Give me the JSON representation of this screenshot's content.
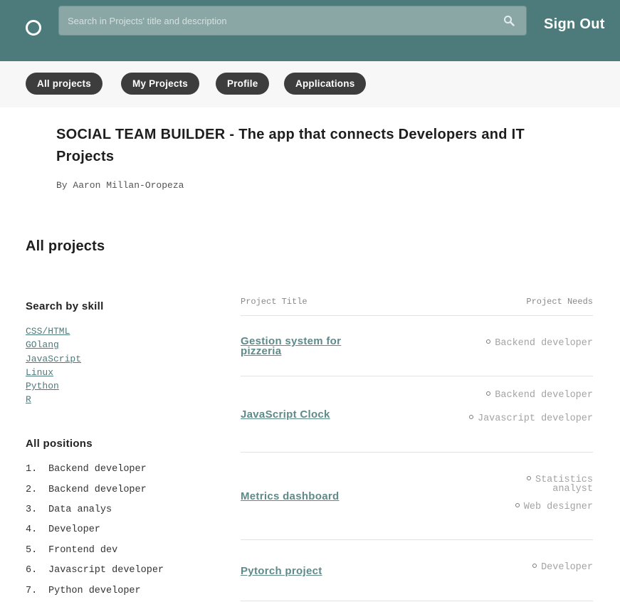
{
  "header": {
    "search_placeholder": "Search in Projects' title and description",
    "sign_out_label": "Sign Out"
  },
  "nav": {
    "all_projects": "All projects",
    "my_projects": "My Projects",
    "profile": "Profile",
    "applications": "Applications"
  },
  "hero": {
    "title": "SOCIAL TEAM BUILDER - The app that connects Developers and IT Projects",
    "byline": "By Aaron Millan-Oropeza"
  },
  "main": {
    "section_title": "All projects"
  },
  "sidebar": {
    "skills_heading": "Search by skill",
    "skills": [
      "CSS/HTML",
      "GOlang",
      "JavaScript",
      "Linux",
      "Python",
      "R"
    ],
    "positions_heading": "All positions",
    "positions": [
      {
        "num": "1.",
        "label": "Backend developer"
      },
      {
        "num": "2.",
        "label": "Backend developer"
      },
      {
        "num": "3.",
        "label": "Data analys"
      },
      {
        "num": "4.",
        "label": "Developer"
      },
      {
        "num": "5.",
        "label": "Frontend dev"
      },
      {
        "num": "6.",
        "label": "Javascript developer"
      },
      {
        "num": "7.",
        "label": "Python developer"
      }
    ]
  },
  "table": {
    "col_title": "Project Title",
    "col_needs": "Project Needs",
    "projects": [
      {
        "title": "Gestion system for pizzeria",
        "needs": [
          "Backend developer"
        ]
      },
      {
        "title": "JavaScript Clock",
        "needs": [
          "Backend developer",
          "Javascript developer"
        ]
      },
      {
        "title": "Metrics dashboard",
        "needs": [
          "Statistics analyst",
          "Web designer"
        ]
      },
      {
        "title": "Pytorch project",
        "needs": [
          "Developer"
        ]
      }
    ]
  },
  "colors": {
    "header_bg": "#4d7b7b",
    "pill_bg": "#3d3d3d",
    "link": "#5e8a8a"
  },
  "icons": [
    "logo-circle-icon",
    "search-icon",
    "bullet-circle-icon"
  ]
}
